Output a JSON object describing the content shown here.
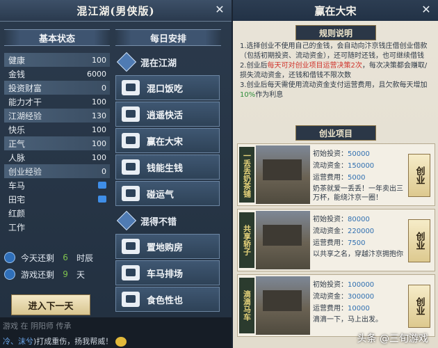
{
  "left_panel": {
    "title": "混江湖(男侠版)",
    "close_label": "✕",
    "basic_status": {
      "heading": "基本状态",
      "stats": [
        {
          "label": "健康",
          "value": "100"
        },
        {
          "label": "金钱",
          "value": "6000"
        },
        {
          "label": "投资财富",
          "value": "0"
        },
        {
          "label": "能力才干",
          "value": "100"
        },
        {
          "label": "江湖经验",
          "value": "130"
        },
        {
          "label": "快乐",
          "value": "100"
        },
        {
          "label": "正气",
          "value": "100"
        },
        {
          "label": "人脉",
          "value": "100"
        },
        {
          "label": "创业经验",
          "value": "0"
        },
        {
          "label": "车马",
          "value": ""
        },
        {
          "label": "田宅",
          "value": ""
        },
        {
          "label": "红颜",
          "value": ""
        },
        {
          "label": "工作",
          "value": ""
        }
      ]
    },
    "timers": [
      {
        "label": "今天还剩",
        "value": "6",
        "unit": "时辰"
      },
      {
        "label": "游戏还剩",
        "value": "9",
        "unit": "天"
      }
    ],
    "next_day_button": "进入下一天",
    "daily": {
      "heading": "每日安排",
      "category1": "混在江湖",
      "category2": "混得不错",
      "actions1": [
        "混口饭吃",
        "逍遥快活",
        "赢在大宋",
        "钱能生钱",
        "碰运气"
      ],
      "actions2": [
        "置地购房",
        "车马排场",
        "食色性也"
      ]
    },
    "chat": {
      "line1": "游戏 在 阴阳师 传承",
      "line2_names": "冷、沫兮",
      "line2_text": ")打成重伤，扬我帮威！"
    }
  },
  "right_panel": {
    "title": "赢在大宋",
    "close_label": "✕",
    "rules_heading": "规则说明",
    "rules": {
      "r1": "1.选择创业不使用自己的金钱，会自动向汴京钱庄借创业借款（包括初期投资、流动资金），还可随时还钱，也可继续借钱",
      "r2a": "2.创业后",
      "r2red": "每天可对创业项目运营决策2次",
      "r2b": "，每次决策都会赚取/损失流动资金，还钱和借钱不限次数",
      "r3a": "3.创业后每天需使用流动资金支付运营费用，且欠款每天增加",
      "r3green": "10%",
      "r3b": "作为利息"
    },
    "projects_heading": "创业项目",
    "projects": [
      {
        "name": "一丢丢奶茶铺",
        "l1": "初始投资：",
        "v1": "50000",
        "l2": "流动资金：",
        "v2": "150000",
        "l3": "运营费用：",
        "v3": "5000",
        "desc": "奶茶就爱一丢丢！一年卖出三万杯，能绕汴京一圈！",
        "btn": "创业"
      },
      {
        "name": "共享轿子",
        "l1": "初始投资：",
        "v1": "80000",
        "l2": "流动资金：",
        "v2": "220000",
        "l3": "运营费用：",
        "v3": "7500",
        "desc": "以共享之名，穿越汴京拥抱你",
        "btn": "创业"
      },
      {
        "name": "滴滴马车",
        "l1": "初始投资：",
        "v1": "100000",
        "l2": "流动资金：",
        "v2": "300000",
        "l3": "运营费用：",
        "v3": "10000",
        "desc": "滴滴一下，马上出发。",
        "btn": "创业"
      }
    ],
    "watermark": "头条 @三旬游戏"
  }
}
